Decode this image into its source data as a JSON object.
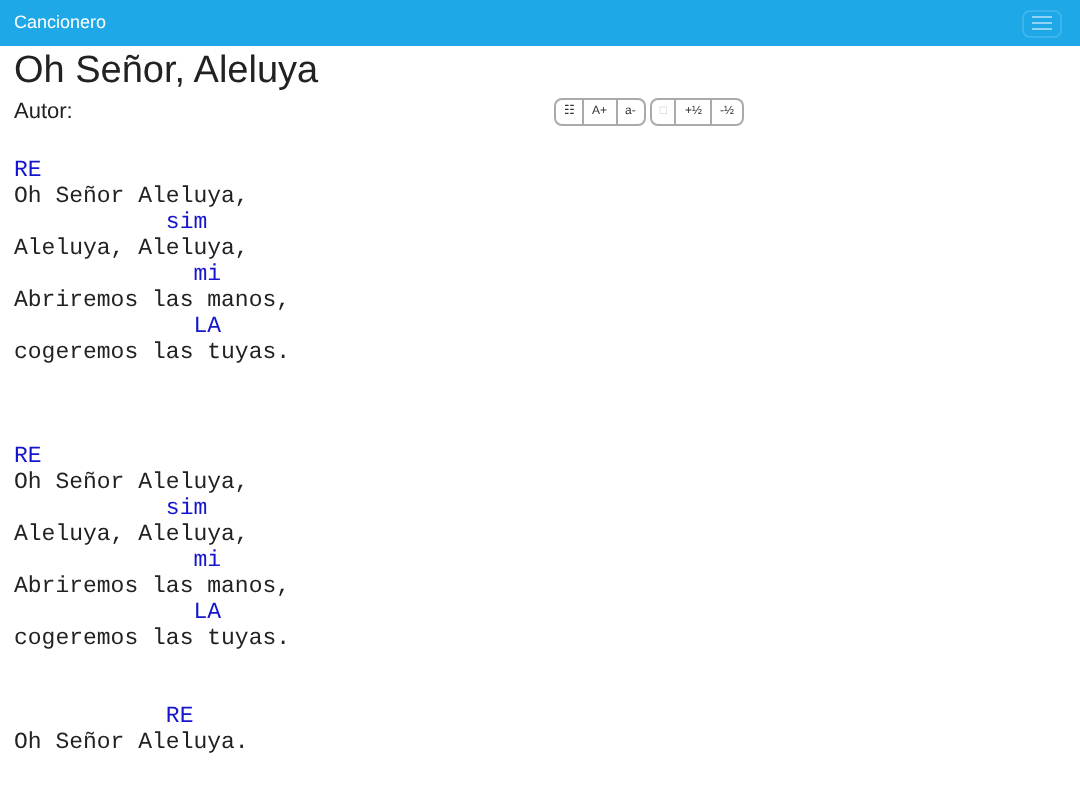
{
  "navbar": {
    "brand": "Cancionero"
  },
  "song": {
    "title": "Oh Señor, Aleluya",
    "author_label": "Autor:"
  },
  "toolbar": [
    [
      {
        "label": "☷",
        "disabled": false
      },
      {
        "label": "A+",
        "disabled": false
      },
      {
        "label": "a-",
        "disabled": false
      }
    ],
    [
      {
        "label": "□",
        "disabled": true
      },
      {
        "label": "+½",
        "disabled": false
      },
      {
        "label": "-½",
        "disabled": false
      }
    ]
  ],
  "lines": [
    {
      "kind": "blank"
    },
    {
      "kind": "chord",
      "text": "RE"
    },
    {
      "kind": "lyric",
      "text": "Oh Señor Aleluya,"
    },
    {
      "kind": "chord",
      "text": "           sim"
    },
    {
      "kind": "lyric",
      "text": "Aleluya, Aleluya,"
    },
    {
      "kind": "chord",
      "text": "             mi"
    },
    {
      "kind": "lyric",
      "text": "Abriremos las manos,"
    },
    {
      "kind": "chord",
      "text": "             LA"
    },
    {
      "kind": "lyric",
      "text": "cogeremos las tuyas."
    },
    {
      "kind": "blank"
    },
    {
      "kind": "blank"
    },
    {
      "kind": "blank"
    },
    {
      "kind": "chord",
      "text": "RE"
    },
    {
      "kind": "lyric",
      "text": "Oh Señor Aleluya,"
    },
    {
      "kind": "chord",
      "text": "           sim"
    },
    {
      "kind": "lyric",
      "text": "Aleluya, Aleluya,"
    },
    {
      "kind": "chord",
      "text": "             mi"
    },
    {
      "kind": "lyric",
      "text": "Abriremos las manos,"
    },
    {
      "kind": "chord",
      "text": "             LA"
    },
    {
      "kind": "lyric",
      "text": "cogeremos las tuyas."
    },
    {
      "kind": "blank"
    },
    {
      "kind": "blank"
    },
    {
      "kind": "chord",
      "text": "           RE"
    },
    {
      "kind": "lyric",
      "text": "Oh Señor Aleluya."
    }
  ]
}
